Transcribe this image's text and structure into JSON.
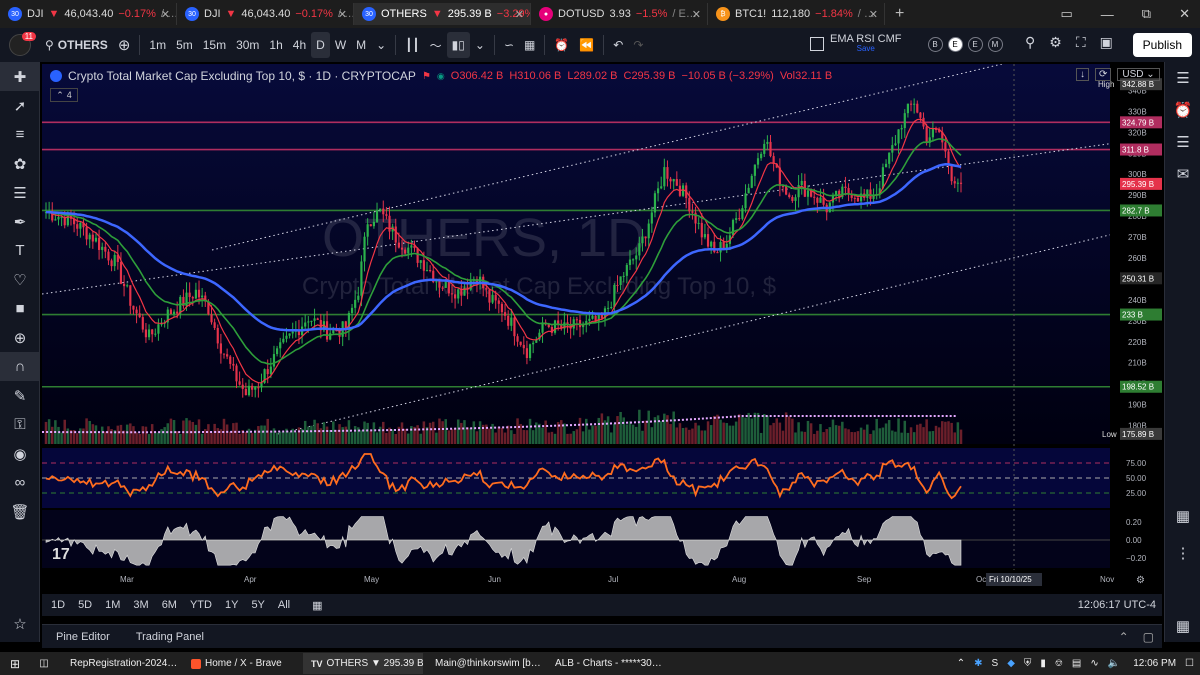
{
  "browser_tabs": [
    {
      "title": "DJI",
      "price": "46,043.40",
      "change": "−0.17%",
      "suffix": "/ …",
      "icon": "tradingview-favicon"
    },
    {
      "title": "DJI",
      "price": "46,043.40",
      "change": "−0.17%",
      "suffix": "/ …",
      "icon": "tradingview-favicon"
    },
    {
      "title": "OTHERS",
      "price": "295.39 B",
      "change": "−3.29%",
      "suffix": "",
      "icon": "tradingview-favicon",
      "active": true
    },
    {
      "title": "DOTUSD",
      "price": "3.93",
      "change": "−1.5%",
      "suffix": "/ E…",
      "icon": "polkadot-favicon"
    },
    {
      "title": "BTC1!",
      "price": "112,180",
      "change": "−1.84%",
      "suffix": "/ …",
      "icon": "bitcoin-favicon"
    }
  ],
  "toolbar": {
    "symbol": "OTHERS",
    "avatar_badge": "11",
    "timeframes": [
      "1m",
      "5m",
      "15m",
      "30m",
      "1h",
      "4h",
      "D",
      "W",
      "M"
    ],
    "selected_timeframe": "D",
    "indicator_name": "EMA RSI CMF",
    "indicator_sub": "Save",
    "circle_buttons": [
      "B",
      "E",
      "E",
      "M"
    ],
    "publish_label": "Publish"
  },
  "legend": {
    "title": "Crypto Total Market Cap Excluding Top 10, $ · 1D · CRYPTOCAP",
    "open": "O306.42 B",
    "high": "H310.06 B",
    "low": "L289.02 B",
    "close": "C295.39 B",
    "change": "−10.05 B (−3.29%)",
    "volume": "Vol32.11 B",
    "collapsed_count": "4",
    "currency": "USD"
  },
  "watermark": {
    "symbol": "OTHERS, 1D",
    "description": "Crypto Total Market Cap Excluding Top 10, $"
  },
  "price_tags": {
    "high_label": "High",
    "high_value": "342.88 B",
    "low_label": "Low",
    "low_value": "175.89 B",
    "current": "295.39 B",
    "levels": [
      {
        "value": "324.79 B",
        "color": "#b02d5f"
      },
      {
        "value": "311.8 B",
        "color": "#b02d5f"
      },
      {
        "value": "282.7 B",
        "color": "#2e7d32"
      },
      {
        "value": "250.31 B",
        "color": "#262626"
      },
      {
        "value": "233 B",
        "color": "#2e7d32"
      },
      {
        "value": "198.52 B",
        "color": "#2e7d32"
      }
    ]
  },
  "price_axis_ticks": [
    "340B",
    "330B",
    "320B",
    "310B",
    "300B",
    "290B",
    "280B",
    "270B",
    "260B",
    "250B",
    "240B",
    "230B",
    "220B",
    "210B",
    "200B",
    "190B",
    "180B"
  ],
  "rsi_ticks": [
    "75.00",
    "50.00",
    "25.00"
  ],
  "cmf_ticks": [
    "0.20",
    "0.00",
    "−0.20"
  ],
  "time_axis": [
    "Mar",
    "Apr",
    "May",
    "Jun",
    "Jul",
    "Aug",
    "Sep",
    "Oct",
    "Nov"
  ],
  "crosshair_date": "Fri 10/10/25",
  "chart_data": {
    "type": "candlestick",
    "title": "Crypto Total Market Cap Excluding Top 10, $ · 1D · CRYPTOCAP",
    "ylabel": "",
    "ylim": [
      175,
      345
    ],
    "horizontal_levels": [
      324.79,
      311.8,
      282.7,
      233,
      198.52
    ],
    "close_path": [
      [
        0,
        282
      ],
      [
        8,
        278
      ],
      [
        15,
        270
      ],
      [
        22,
        258
      ],
      [
        28,
        236
      ],
      [
        33,
        222
      ],
      [
        38,
        232
      ],
      [
        43,
        238
      ],
      [
        48,
        244
      ],
      [
        52,
        236
      ],
      [
        56,
        218
      ],
      [
        60,
        205
      ],
      [
        64,
        195
      ],
      [
        68,
        200
      ],
      [
        72,
        210
      ],
      [
        78,
        222
      ],
      [
        84,
        232
      ],
      [
        90,
        225
      ],
      [
        96,
        226
      ],
      [
        100,
        245
      ],
      [
        103,
        278
      ],
      [
        107,
        282
      ],
      [
        112,
        270
      ],
      [
        118,
        262
      ],
      [
        122,
        256
      ],
      [
        126,
        248
      ],
      [
        132,
        244
      ],
      [
        138,
        252
      ],
      [
        142,
        240
      ],
      [
        146,
        236
      ],
      [
        150,
        226
      ],
      [
        154,
        216
      ],
      [
        160,
        228
      ],
      [
        166,
        226
      ],
      [
        172,
        228
      ],
      [
        178,
        230
      ],
      [
        184,
        250
      ],
      [
        190,
        264
      ],
      [
        194,
        282
      ],
      [
        198,
        302
      ],
      [
        202,
        296
      ],
      [
        206,
        286
      ],
      [
        210,
        272
      ],
      [
        214,
        262
      ],
      [
        218,
        268
      ],
      [
        222,
        282
      ],
      [
        226,
        300
      ],
      [
        230,
        318
      ],
      [
        234,
        300
      ],
      [
        238,
        290
      ],
      [
        242,
        294
      ],
      [
        246,
        290
      ],
      [
        250,
        284
      ],
      [
        254,
        290
      ],
      [
        258,
        292
      ],
      [
        262,
        288
      ],
      [
        266,
        292
      ],
      [
        270,
        308
      ],
      [
        274,
        325
      ],
      [
        278,
        335
      ],
      [
        282,
        318
      ],
      [
        286,
        320
      ],
      [
        290,
        300
      ],
      [
        293,
        295.39
      ]
    ],
    "ema_fast_color": "#f23645",
    "ema_mid_color": "#2e9e3a",
    "ema_slow_color": "#3d67ff",
    "rsi_range": [
      0,
      100
    ],
    "cmf_range": [
      -0.3,
      0.3
    ]
  },
  "timeframe_bar": {
    "ranges": [
      "1D",
      "5D",
      "1M",
      "3M",
      "6M",
      "YTD",
      "1Y",
      "5Y",
      "All"
    ],
    "clock": "12:06:17 UTC-4"
  },
  "bottom_panel": {
    "tabs": [
      "Pine Editor",
      "Trading Panel"
    ]
  },
  "taskbar": {
    "apps": [
      {
        "label": "RepRegistration-2024…",
        "icon": "excel-icon"
      },
      {
        "label": "Home / X - Brave",
        "icon": "brave-icon"
      },
      {
        "label": "OTHERS ▼ 295.39 B –…",
        "icon": "tradingview-icon"
      },
      {
        "label": "Main@thinkorswim [b…",
        "icon": "thinkorswim-icon"
      },
      {
        "label": "ALB - Charts - *****30…",
        "icon": "thinkorswim-icon"
      }
    ],
    "time": "12:06 PM"
  }
}
